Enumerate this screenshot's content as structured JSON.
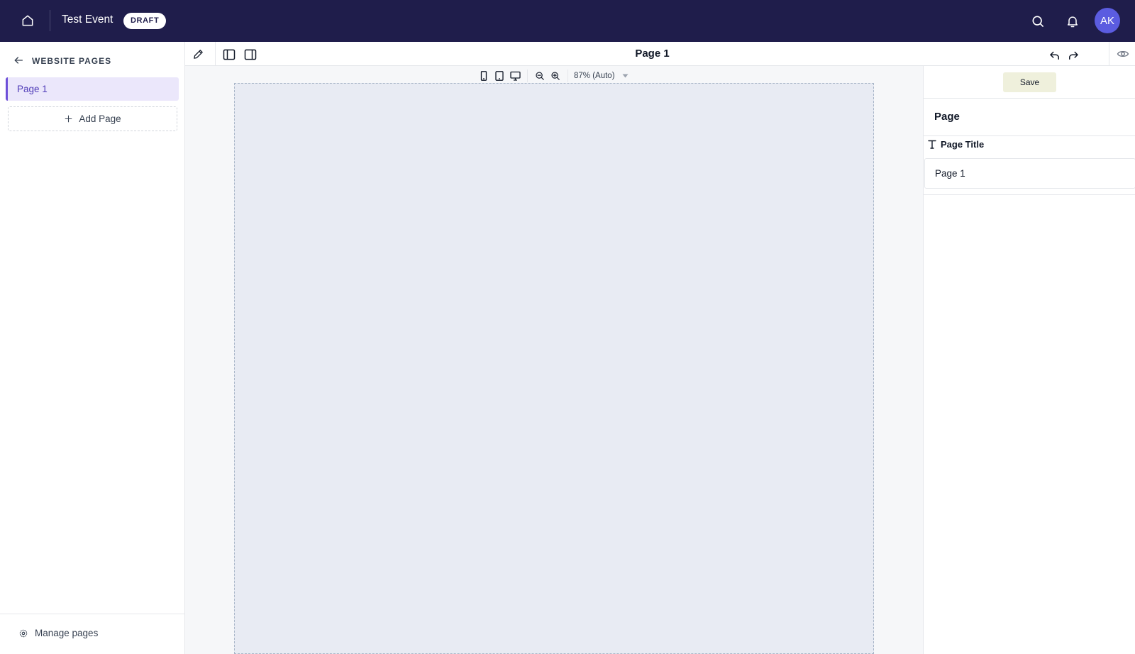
{
  "header": {
    "event_title": "Test Event",
    "status_badge": "DRAFT",
    "avatar_initials": "AK",
    "icons": [
      "home-icon",
      "search-icon",
      "bell-icon"
    ]
  },
  "sidebar": {
    "heading": "WEBSITE PAGES",
    "pages": [
      {
        "label": "Page 1",
        "active": true
      }
    ],
    "add_page_label": "Add Page",
    "manage_label": "Manage pages"
  },
  "toolbar": {
    "page_title": "Page 1",
    "icons": [
      "pencil-icon",
      "left-panel-icon",
      "right-panel-icon",
      "undo-icon",
      "redo-icon",
      "eye-icon"
    ]
  },
  "viewbar": {
    "zoom_label": "87% (Auto)",
    "device_icons": [
      "mobile-icon",
      "tablet-icon",
      "desktop-icon"
    ],
    "zoom_icons": [
      "zoom-out-icon",
      "zoom-in-icon"
    ]
  },
  "right_panel": {
    "save_label": "Save",
    "section_title": "Page",
    "field_label": "Page Title",
    "field_value": "Page 1"
  },
  "colors": {
    "topbar_bg": "#1f1d4b",
    "accent": "#6d4fd8",
    "active_item_bg": "#ebe7fb",
    "avatar_bg": "#5b5ce0",
    "canvas_bg": "#e8ebf3",
    "save_bg": "#eff0dc"
  }
}
